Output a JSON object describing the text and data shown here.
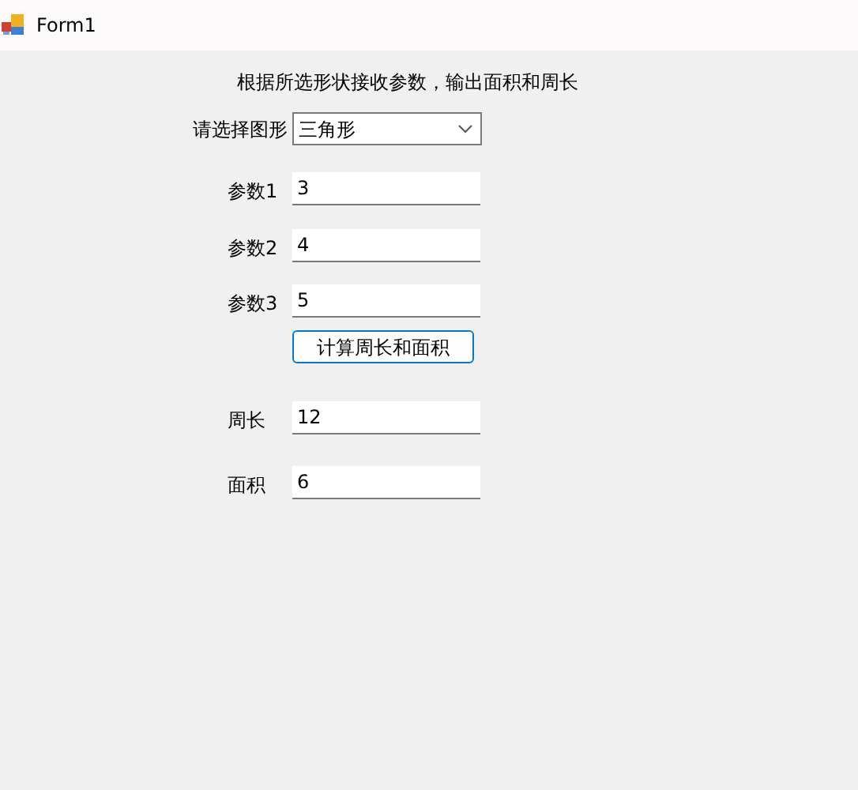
{
  "window": {
    "title": "Form1"
  },
  "heading": "根据所选形状接收参数，输出面积和周长",
  "rows": [
    {
      "kind": "combo",
      "label": "请选择图形",
      "value": "三角形"
    },
    {
      "kind": "input",
      "label": "参数1",
      "value": "3"
    },
    {
      "kind": "input",
      "label": "参数2",
      "value": "4"
    },
    {
      "kind": "input",
      "label": "参数3",
      "value": "5"
    },
    {
      "kind": "button",
      "label": "计算周长和面积"
    },
    {
      "kind": "input",
      "label": "周长",
      "value": "12"
    },
    {
      "kind": "input",
      "label": "面积",
      "value": "6"
    }
  ]
}
